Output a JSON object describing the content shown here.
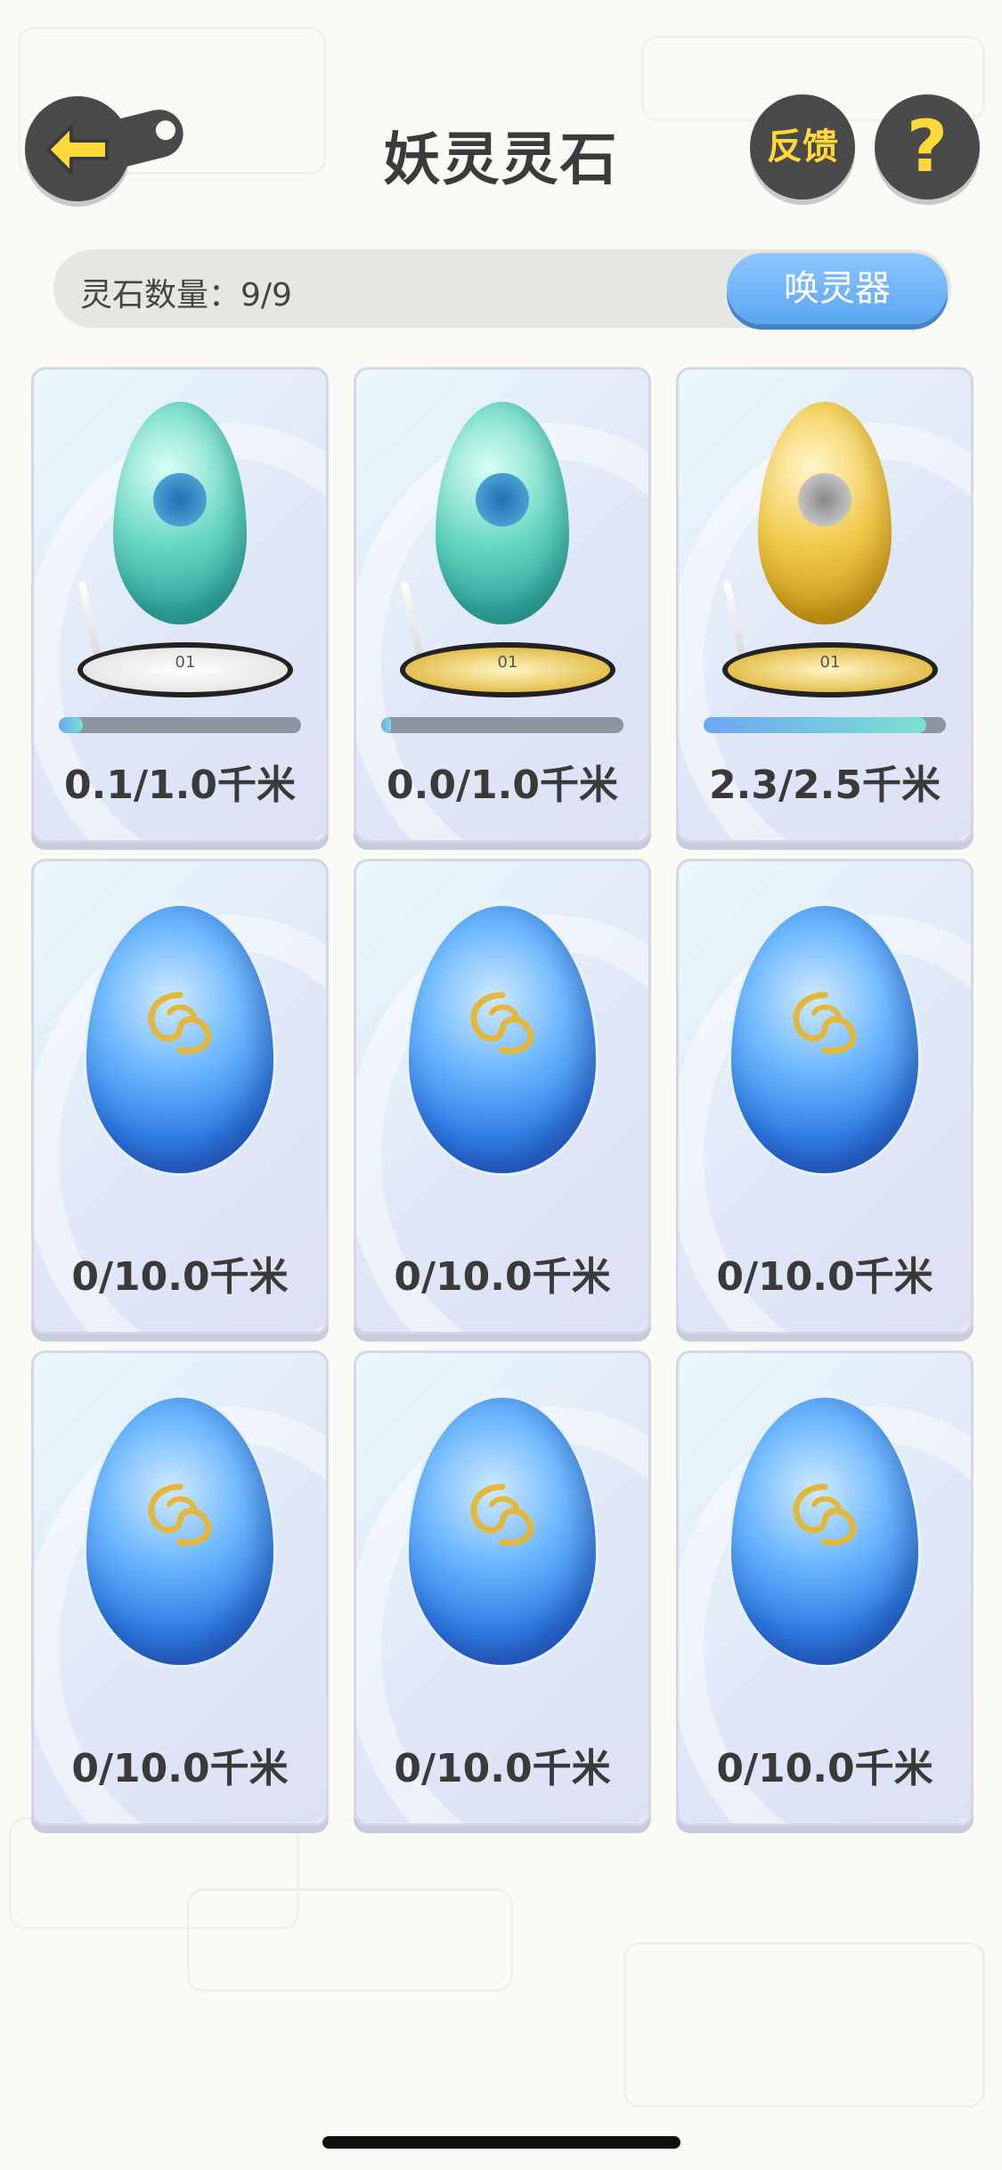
{
  "header": {
    "title": "妖灵灵石",
    "feedback_label": "反馈",
    "help_label": "?"
  },
  "count_bar": {
    "text": "灵石数量：9/9",
    "summon_label": "唤灵器"
  },
  "stones": [
    {
      "distance": "0.1/1.0千米",
      "type": "green-egg",
      "stand": "silver",
      "progress": 0.1,
      "stand_label": "01"
    },
    {
      "distance": "0.0/1.0千米",
      "type": "green-egg",
      "stand": "gold",
      "progress": 0.04,
      "stand_label": "01"
    },
    {
      "distance": "2.3/2.5千米",
      "type": "gold-egg",
      "stand": "gold",
      "progress": 0.92,
      "stand_label": "01"
    },
    {
      "distance": "0/10.0千米",
      "type": "blue-crystal"
    },
    {
      "distance": "0/10.0千米",
      "type": "blue-crystal"
    },
    {
      "distance": "0/10.0千米",
      "type": "blue-crystal"
    },
    {
      "distance": "0/10.0千米",
      "type": "blue-crystal"
    },
    {
      "distance": "0/10.0千米",
      "type": "blue-crystal"
    },
    {
      "distance": "0/10.0千米",
      "type": "blue-crystal"
    }
  ],
  "colors": {
    "accent_yellow": "#ffd83a",
    "button_dark": "#4a4a4a",
    "summon_blue": "#5aa6f0"
  }
}
